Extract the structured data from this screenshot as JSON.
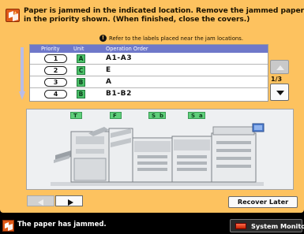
{
  "message": {
    "line1": "Paper is jammed in the indicated location. Remove the jammed paper",
    "line2": "in the priority shown. (When finished, close the covers.)"
  },
  "refer_note": "Refer to the labels placed near the jam locations.",
  "table": {
    "headers": {
      "priority": "Priority",
      "unit": "Unit",
      "operation": "Operation Order"
    },
    "rows": [
      {
        "priority": "1",
        "unit": "A",
        "operation": "A1-A3"
      },
      {
        "priority": "2",
        "unit": "C",
        "operation": "E"
      },
      {
        "priority": "3",
        "unit": "B",
        "operation": "A"
      },
      {
        "priority": "4",
        "unit": "B",
        "operation": "B1-B2"
      }
    ]
  },
  "pager": {
    "indicator": "1/3"
  },
  "diagram": {
    "labels": [
      {
        "letter": "T",
        "suffix": ""
      },
      {
        "letter": "F",
        "suffix": ""
      },
      {
        "letter": "S",
        "suffix": "b"
      },
      {
        "letter": "S",
        "suffix": "a"
      }
    ]
  },
  "buttons": {
    "recover_later": "Recover Later"
  },
  "status": {
    "text": "The paper has jammed.",
    "system_monitor": "System Monitor"
  },
  "colors": {
    "panel": "#fdc25f",
    "unit_green": "#4cc26a",
    "header_blue": "#6f78c9",
    "jam_orange": "#e05a18"
  },
  "icons": {
    "jam": "paper-jam-icon",
    "info": "info-icon",
    "up": "arrow-up-icon",
    "down": "arrow-down-icon"
  }
}
